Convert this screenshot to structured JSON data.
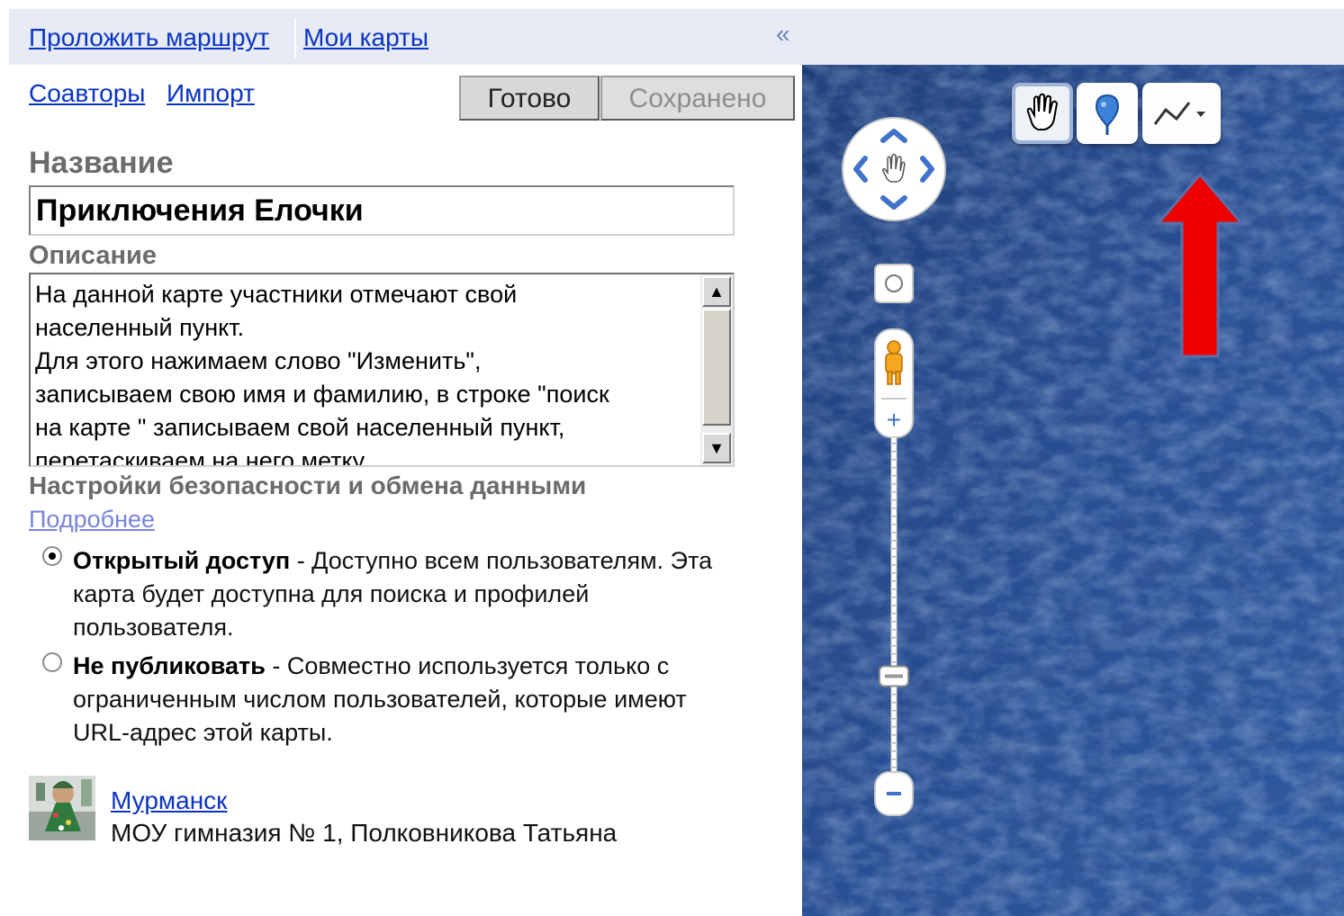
{
  "sidebar": {
    "tabs": {
      "route": "Проложить маршрут",
      "my_maps": "Мои карты",
      "collapse": "«"
    },
    "links": {
      "coauthors": "Соавторы",
      "import": "Импорт"
    },
    "buttons": {
      "done": "Готово",
      "saved": "Сохранено"
    },
    "title_label": "Название",
    "title_value": "Приключения Елочки",
    "description_label": "Описание",
    "description_text": "На данной карте участники отмечают свой\nнаселенный пункт.\nДля этого нажимаем слово \"Изменить\",\nзаписываем свою имя и фамилию, в строке \"поиск\nна карте \" записываем свой населенный пункт,\nперетаскиваем на него метку",
    "privacy": {
      "label": "Настройки безопасности и обмена данными",
      "more_link": "Подробнее",
      "options": [
        {
          "title": "Открытый доступ",
          "desc": " - Доступно всем пользователям. Эта карта будет доступна для поиска и профилей пользователя.",
          "selected": true
        },
        {
          "title": "Не публиковать",
          "desc": " - Совместно используется только с ограниченным числом пользователей, которые имеют URL-адрес этой карты.",
          "selected": false
        }
      ]
    },
    "author": {
      "name": "Мурманск",
      "org": "МОУ гимназия № 1, Полковникова Татьяна"
    }
  },
  "map": {
    "toolbar": {
      "tools": [
        "hand-icon",
        "marker-icon",
        "line-icon"
      ],
      "active_tool": "hand-icon"
    },
    "zoom": {
      "plus": "+",
      "minus": "−",
      "level": 0.25
    },
    "annotation": {
      "color": "#ee0000",
      "icon": "up-arrow"
    }
  }
}
